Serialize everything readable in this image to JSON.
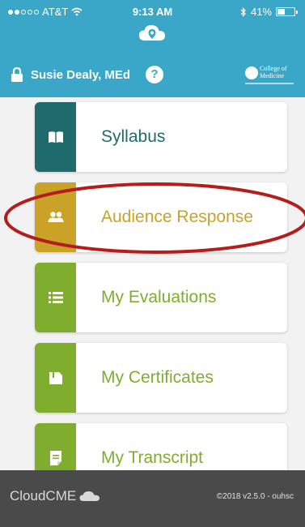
{
  "status_bar": {
    "carrier": "AT&T",
    "time": "9:13 AM",
    "battery": "41%"
  },
  "header": {
    "user_name": "Susie Dealy, MEd",
    "help_label": "?",
    "college_line1": "College of",
    "college_line2": "Medicine"
  },
  "menu": {
    "items": [
      {
        "label": "Syllabus",
        "band_color": "#1f6b6b",
        "text_color": "#1f6b6b",
        "icon": "book-icon"
      },
      {
        "label": "Audience Response",
        "band_color": "#c9a227",
        "text_color": "#c9a227",
        "icon": "people-icon"
      },
      {
        "label": "My Evaluations",
        "band_color": "#7fae2e",
        "text_color": "#7fae2e",
        "icon": "list-icon"
      },
      {
        "label": "My Certificates",
        "band_color": "#7fae2e",
        "text_color": "#7fae2e",
        "icon": "certificate-icon"
      },
      {
        "label": "My Transcript",
        "band_color": "#7fae2e",
        "text_color": "#7fae2e",
        "icon": "document-icon"
      }
    ]
  },
  "footer": {
    "brand": "CloudCME",
    "version": "©2018 v2.5.0 - ouhsc"
  },
  "colors": {
    "header_bg": "#3aa6c8",
    "footer_bg": "#4a4a4a",
    "annotation": "#b51d1d"
  }
}
